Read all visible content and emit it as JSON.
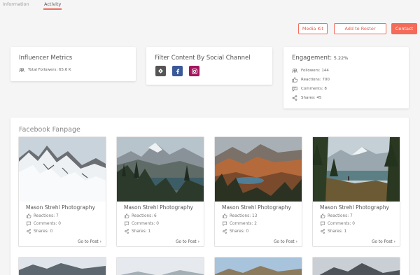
{
  "tabs": [
    {
      "label": "Information"
    },
    {
      "label": "Activity"
    }
  ],
  "actions": {
    "media_kit": "Media Kit",
    "add_to_roster": "Add to Roster",
    "contact": "Contact"
  },
  "metrics": {
    "title": "Influencer Metrics",
    "total_followers": "Total Followers: 65.6 K"
  },
  "filter": {
    "title": "Filter Content By Social Channel",
    "channels": [
      "tiktok",
      "facebook",
      "instagram"
    ]
  },
  "engagement": {
    "title": "Engagement:",
    "rate": "5.22%",
    "followers": "Followers: 144",
    "reactions": "Reactions: 700",
    "comments": "Comments: 8",
    "shares": "Shares: 45"
  },
  "section": {
    "title": "Facebook Fanpage"
  },
  "posts": [
    {
      "author": "Mason Strehl Photography",
      "reactions": "Reactions: 7",
      "comments": "Comments: 0",
      "shares": "Shares: 0",
      "cta": "Go to Post"
    },
    {
      "author": "Mason Strehl Photography",
      "reactions": "Reactions: 6",
      "comments": "Comments: 0",
      "shares": "Shares: 1",
      "cta": "Go to Post"
    },
    {
      "author": "Mason Strehl Photography",
      "reactions": "Reactions: 13",
      "comments": "Comments: 2",
      "shares": "Shares: 0",
      "cta": "Go to Post"
    },
    {
      "author": "Mason Strehl Photography",
      "reactions": "Reactions: 7",
      "comments": "Comments: 0",
      "shares": "Shares: 1",
      "cta": "Go to Post"
    }
  ],
  "colors": {
    "accent": "#f26d5b",
    "facebook": "#3b5998",
    "instagram": "#a3175d",
    "tiktok": "#555555"
  }
}
